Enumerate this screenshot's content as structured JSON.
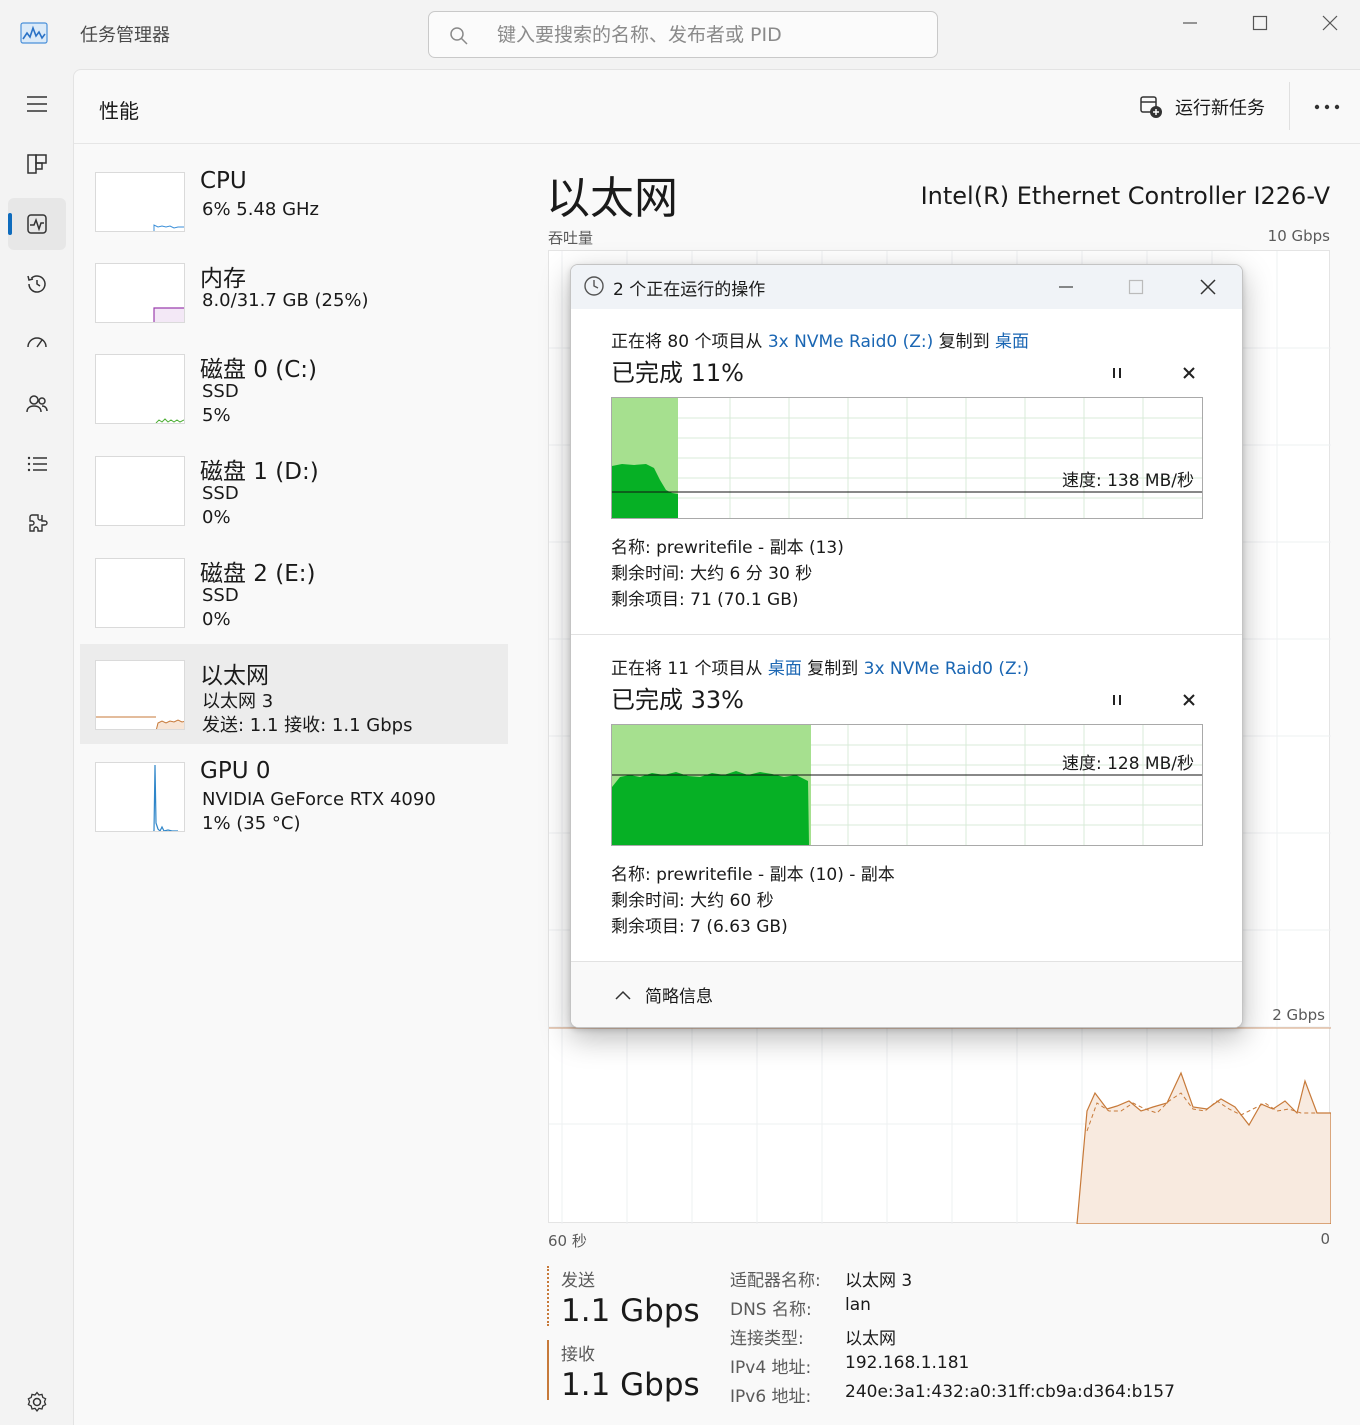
{
  "app": {
    "title": "任务管理器",
    "search_placeholder": "键入要搜索的名称、发布者或 PID"
  },
  "header": {
    "page_title": "性能",
    "run_task_label": "运行新任务"
  },
  "devices": [
    {
      "name": "CPU",
      "line1": "6%  5.48 GHz",
      "line2": ""
    },
    {
      "name": "内存",
      "line1": "8.0/31.7 GB (25%)",
      "line2": ""
    },
    {
      "name": "磁盘 0 (C:)",
      "line1": "SSD",
      "line2": "5%"
    },
    {
      "name": "磁盘 1 (D:)",
      "line1": "SSD",
      "line2": "0%"
    },
    {
      "name": "磁盘 2 (E:)",
      "line1": "SSD",
      "line2": "0%"
    },
    {
      "name": "以太网",
      "line1": "以太网 3",
      "line2": "发送: 1.1  接收: 1.1 Gbps"
    },
    {
      "name": "GPU 0",
      "line1": "NVIDIA GeForce RTX 4090",
      "line2": "1%  (35 °C)"
    }
  ],
  "detail": {
    "title": "以太网",
    "adapter": "Intel(R) Ethernet Controller I226-V",
    "throughput_label": "吞吐量",
    "max_label": "10 Gbps",
    "mid_label": "2 Gbps",
    "time_left": "60 秒",
    "time_right": "0",
    "send_label": "发送",
    "send_value": "1.1 Gbps",
    "recv_label": "接收",
    "recv_value": "1.1 Gbps",
    "props": [
      {
        "k": "适配器名称:",
        "v": "以太网 3"
      },
      {
        "k": "DNS 名称:",
        "v": "lan"
      },
      {
        "k": "连接类型:",
        "v": "以太网"
      },
      {
        "k": "IPv4 地址:",
        "v": "192.168.1.181"
      },
      {
        "k": "IPv6 地址:",
        "v": "240e:3a1:432:a0:31ff:cb9a:d364:b157"
      }
    ]
  },
  "dialog": {
    "title": "2 个正在运行的操作",
    "footer_label": "简略信息",
    "operations": [
      {
        "desc_pre": "正在将 80 个项目从 ",
        "source": "3x NVMe Raid0 (Z:)",
        "desc_mid": " 复制到 ",
        "dest": "桌面",
        "percent_text": "已完成 11%",
        "progress_fraction": 0.11,
        "speed": "速度: 138 MB/秒",
        "name": "名称:  prewritefile - 副本 (13)",
        "remaining_time": "剩余时间:  大约 6 分 30 秒",
        "remaining_items": "剩余项目:  71 (70.1 GB)"
      },
      {
        "desc_pre": "正在将 11 个项目从 ",
        "source": "桌面",
        "desc_mid": " 复制到 ",
        "dest": "3x NVMe Raid0 (Z:)",
        "percent_text": "已完成 33%",
        "progress_fraction": 0.33,
        "speed": "速度: 128 MB/秒",
        "name": "名称:  prewritefile - 副本 (10) - 副本",
        "remaining_time": "剩余时间:  大约 60 秒",
        "remaining_items": "剩余项目:  7 (6.63 GB)"
      }
    ]
  },
  "colors": {
    "accent": "#0f6cbd",
    "ethernet": "#c77a3a",
    "progress_light": "#a6e08f",
    "progress_dark": "#06b025",
    "link": "#1a66b3"
  }
}
